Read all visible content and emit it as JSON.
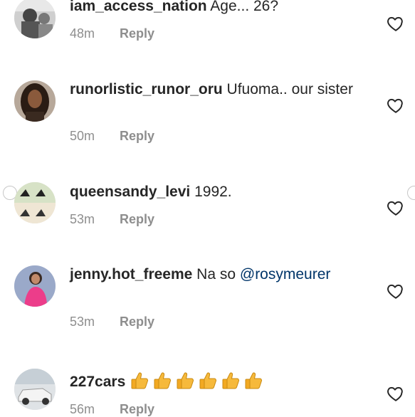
{
  "comments": [
    {
      "username": "iam_access_nation",
      "text": "Age... 26?",
      "time": "48m",
      "reply_label": "Reply",
      "avatar_icon": "grayscale-photo-avatar"
    },
    {
      "username": "runorlistic_runor_oru",
      "text": "Ufuoma.. our sister",
      "time": "50m",
      "reply_label": "Reply",
      "avatar_icon": "portrait-woman-avatar"
    },
    {
      "username": "queensandy_levi",
      "text": "1992.",
      "time": "53m",
      "reply_label": "Reply",
      "avatar_icon": "collage-avatar"
    },
    {
      "username": "jenny.hot_freeme",
      "text": "Na so",
      "mention": "@rosymeurer",
      "time": "53m",
      "reply_label": "Reply",
      "avatar_icon": "pink-outfit-avatar"
    },
    {
      "username": "227cars",
      "text": "",
      "emoji": [
        "👍",
        "👍",
        "👍",
        "👍",
        "👍",
        "👍"
      ],
      "time": "56m",
      "reply_label": "Reply",
      "avatar_icon": "car-avatar"
    }
  ],
  "colors": {
    "text": "#262626",
    "meta": "#8e8e8e",
    "mention": "#003569",
    "heart_stroke": "#262626"
  }
}
